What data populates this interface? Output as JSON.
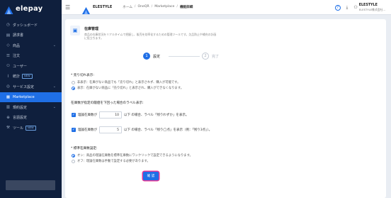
{
  "app": {
    "logo_text": "elepay",
    "name": "ELESTYLE"
  },
  "sidebar": {
    "items": [
      {
        "icon": "dashboard-icon",
        "glyph": "◷",
        "label": "ダッシュボード",
        "chevron": false,
        "active": false
      },
      {
        "icon": "invoice-icon",
        "glyph": "▤",
        "label": "請求書",
        "chevron": false,
        "active": false
      },
      {
        "icon": "tag-icon",
        "glyph": "◇",
        "label": "商品",
        "chevron": true,
        "active": false
      },
      {
        "icon": "order-icon",
        "glyph": "☰",
        "label": "注文",
        "chevron": false,
        "active": false
      },
      {
        "icon": "user-icon",
        "glyph": "⚇",
        "label": "ユーザー",
        "chevron": false,
        "active": false
      },
      {
        "icon": "analytics-icon",
        "glyph": "⌇",
        "label": "統計",
        "chevron": false,
        "active": false,
        "badge": "NEW"
      },
      {
        "icon": "service-icon",
        "glyph": "◎",
        "label": "サービス設定",
        "chevron": true,
        "active": false
      },
      {
        "icon": "marketplace-icon",
        "glyph": "▦",
        "label": "Marketplace",
        "chevron": false,
        "active": true
      },
      {
        "icon": "contract-icon",
        "glyph": "▥",
        "label": "規約設定",
        "chevron": true,
        "active": false
      },
      {
        "icon": "language-icon",
        "glyph": "⊕",
        "label": "言語設定",
        "chevron": false,
        "active": false
      },
      {
        "icon": "tool-icon",
        "glyph": "⚒",
        "label": "ツール",
        "chevron": false,
        "active": false,
        "badge": "NEW"
      }
    ]
  },
  "topbar": {
    "breadcrumbs": [
      "ホーム",
      "OneQR",
      "Marketplace",
      "機能詳細"
    ],
    "user_name": "ELESTYLE",
    "user_sub": "ELESTYLE株式会社..."
  },
  "plugin": {
    "title": "在庫管理",
    "description": "商品の在庫状況をリアルタイムで把握し、販売を効率化するための管理ツールです。欠品防止や補充の計画に役立ちます。"
  },
  "steps": [
    {
      "number": "1",
      "label": "設定"
    },
    {
      "number": "2",
      "label": "完了"
    }
  ],
  "sold_out": {
    "title": "* 売り切れ表示:",
    "options": [
      "非表示：在庫がない商品でも「売り切れ」と表示されず、購入が可能です。",
      "表示：在庫がない商品に「売り切れ」と表示され、購入ができなくなります。"
    ],
    "selected_index": 1
  },
  "threshold": {
    "title": "在庫数が指定の閾値を下回った場合のラベル表示:",
    "rows": [
      {
        "prefix": "理論在庫数が",
        "value": "10",
        "suffix": "以下 の場合、ラベル「残りわずか」を表示。",
        "checked": true
      },
      {
        "prefix": "理論在庫数が",
        "value": "5",
        "suffix": "以下 の場合、ラベル「残り◯点」を表示（例：「残り3点」）。",
        "checked": true
      }
    ]
  },
  "standard_stock": {
    "title": "* 標準在庫数設定:",
    "options": [
      "オン：商品の理論在庫数を標準在庫数にワンクリックで設定できるようになります。",
      "オフ：理論在庫数は手動で設定する必要があります。"
    ],
    "selected_index": 0
  },
  "submit_label": "確 認"
}
